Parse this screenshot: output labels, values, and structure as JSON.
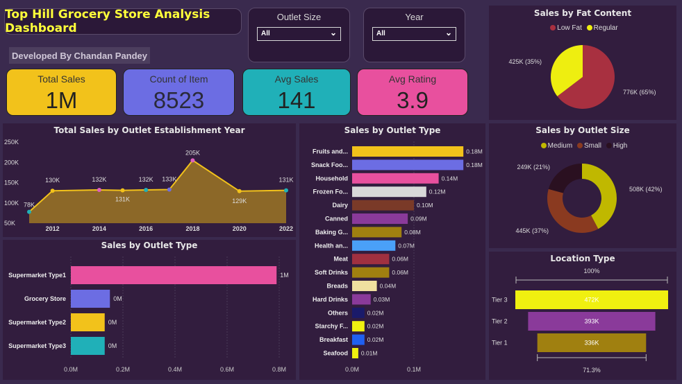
{
  "header": {
    "title": "Top Hill Grocery Store Analysis Dashboard",
    "developer": "Developed By Chandan Pandey"
  },
  "slicers": [
    {
      "label": "Outlet Size",
      "value": "All"
    },
    {
      "label": "Year",
      "value": "All"
    }
  ],
  "kpis": [
    {
      "label": "Total Sales",
      "value": "1M",
      "color": "#f2c21b"
    },
    {
      "label": "Count of Item",
      "value": "8523",
      "color": "#6c6de3"
    },
    {
      "label": "Avg Sales",
      "value": "141",
      "color": "#20b0b8"
    },
    {
      "label": "Avg Rating",
      "value": "3.9",
      "color": "#e8509e"
    }
  ],
  "colors": {
    "background": "#3a2a4e",
    "panel": "#321d3e",
    "title_text": "#ffff3a"
  },
  "chart_data": [
    {
      "type": "area",
      "title": "Total Sales by Outlet Establishment Year",
      "x": [
        2011,
        2012,
        2014,
        2015,
        2016,
        2017,
        2018,
        2020,
        2022
      ],
      "values": [
        78,
        130,
        132,
        131,
        132,
        133,
        205,
        129,
        131
      ],
      "data_labels": [
        "78K",
        "130K",
        "132K",
        "131K",
        "132K",
        "133K",
        "205K",
        "129K",
        "131K"
      ],
      "x_ticks": [
        "2012",
        "2014",
        "2016",
        "2018",
        "2020",
        "2022"
      ],
      "y_ticks": [
        "50K",
        "100K",
        "150K",
        "200K",
        "250K"
      ],
      "ylim": [
        50,
        250
      ],
      "xlim": [
        2011,
        2022
      ],
      "colors": {
        "area": "#8c6828",
        "line": "#f2c21b"
      },
      "marker_colors": [
        "#20b0b8",
        "#f2c21b",
        "#e060c0",
        "#f2c21b",
        "#20b0b8",
        "#7070e0",
        "#e060c0",
        "#f2c21b",
        "#20b0b8"
      ]
    },
    {
      "type": "bar",
      "orientation": "horizontal",
      "title": "Sales by Outlet Type",
      "categories": [
        "Supermarket Type1",
        "Grocery Store",
        "Supermarket Type2",
        "Supermarket Type3"
      ],
      "values": [
        0.79,
        0.15,
        0.13,
        0.13
      ],
      "data_labels": [
        "1M",
        "0M",
        "0M",
        "0M"
      ],
      "colors": [
        "#e8509e",
        "#6c6de3",
        "#f2c21b",
        "#20b0b8"
      ],
      "x_ticks": [
        "0.0M",
        "0.2M",
        "0.4M",
        "0.6M",
        "0.8M"
      ],
      "xlim": [
        0,
        0.8
      ]
    },
    {
      "type": "bar",
      "orientation": "horizontal",
      "title": "Sales by Outlet Type",
      "categories": [
        "Fruits and...",
        "Snack Foo...",
        "Household",
        "Frozen Fo...",
        "Dairy",
        "Canned",
        "Baking G...",
        "Health an...",
        "Meat",
        "Soft Drinks",
        "Breads",
        "Hard Drinks",
        "Others",
        "Starchy F...",
        "Breakfast",
        "Seafood"
      ],
      "values": [
        0.18,
        0.18,
        0.14,
        0.12,
        0.1,
        0.09,
        0.08,
        0.07,
        0.06,
        0.06,
        0.04,
        0.03,
        0.02,
        0.02,
        0.02,
        0.01
      ],
      "data_labels": [
        "0.18M",
        "0.18M",
        "0.14M",
        "0.12M",
        "0.10M",
        "0.09M",
        "0.08M",
        "0.07M",
        "0.06M",
        "0.06M",
        "0.04M",
        "0.03M",
        "0.02M",
        "0.02M",
        "0.02M",
        "0.01M"
      ],
      "colors": [
        "#f2c21b",
        "#6c6de3",
        "#e8509e",
        "#d8d8d8",
        "#7a3a28",
        "#8a3a9a",
        "#a08010",
        "#4aa0f8",
        "#a03040",
        "#a08010",
        "#f0e0a0",
        "#8a3a9a",
        "#1a1a6a",
        "#f0f010",
        "#2060f0",
        "#f0f010"
      ],
      "x_ticks": [
        "0.0M",
        "0.1M"
      ],
      "xlim": [
        0,
        0.2
      ]
    },
    {
      "type": "pie",
      "title": "Sales by Fat Content",
      "categories": [
        "Low Fat",
        "Regular"
      ],
      "values": [
        776,
        425
      ],
      "data_labels": [
        "776K (65%)",
        "425K (35%)"
      ],
      "colors": [
        "#a83040",
        "#eeee10"
      ],
      "legend": "top"
    },
    {
      "type": "pie",
      "subtype": "donut",
      "title": "Sales by Outlet Size",
      "categories": [
        "Medium",
        "Small",
        "High"
      ],
      "values": [
        508,
        445,
        249
      ],
      "data_labels": [
        "508K (42%)",
        "445K (37%)",
        "249K (21%)"
      ],
      "colors": [
        "#c0b800",
        "#8a3a20",
        "#2a1020"
      ],
      "legend": "top"
    },
    {
      "type": "bar",
      "subtype": "funnel",
      "title": "Location Type",
      "categories": [
        "Tier 3",
        "Tier 2",
        "Tier 1"
      ],
      "values": [
        472,
        393,
        336
      ],
      "data_labels": [
        "472K",
        "393K",
        "336K"
      ],
      "colors": [
        "#f0f010",
        "#8a3a9a",
        "#a08010"
      ],
      "top_percent": "100%",
      "bottom_percent": "71.3%"
    }
  ]
}
